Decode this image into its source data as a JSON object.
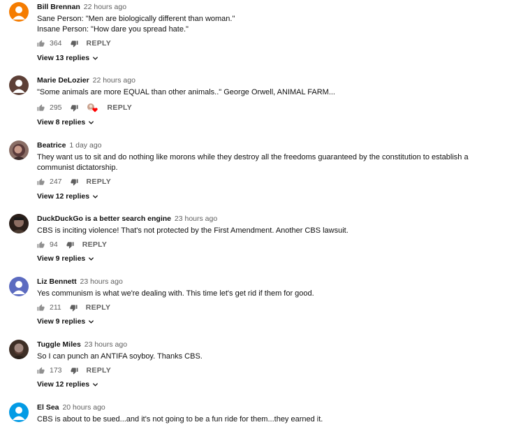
{
  "comments": [
    {
      "author": "Bill Brennan",
      "time": "22 hours ago",
      "text": "Sane Person:  \"Men are biologically different than woman.\"\nInsane Person:  \"How dare you spread hate.\"",
      "likes": "364",
      "reply_label": "REPLY",
      "replies_label": "View 13 replies",
      "avatar_color": "#f57c00",
      "avatar_icon": "person-icon"
    },
    {
      "author": "Marie DeLozier",
      "time": "22 hours ago",
      "text": "\"Some animals are more EQUAL than other animals..\" George Orwell, ANIMAL FARM...",
      "likes": "295",
      "reply_label": "REPLY",
      "replies_label": "View 8 replies",
      "avatar_color": "#5d4037",
      "avatar_icon": "person-icon",
      "creator_heart": true
    },
    {
      "author": "Beatrice",
      "time": "1 day ago",
      "text": "They want us to sit and do nothing like morons while they destroy all the freedoms guaranteed by the constitution to establish a communist dictatorship.",
      "likes": "247",
      "reply_label": "REPLY",
      "replies_label": "View 12 replies",
      "avatar_color": "#6d4c41",
      "avatar_icon": "profile-photo"
    },
    {
      "author": "DuckDuckGo is a better search engine",
      "time": "23 hours ago",
      "text": "CBS is inciting violence! That's not protected by the First Amendment. Another CBS lawsuit.",
      "likes": "94",
      "reply_label": "REPLY",
      "replies_label": "View 9 replies",
      "avatar_color": "#3e2723",
      "avatar_icon": "profile-photo"
    },
    {
      "author": "Liz Bennett",
      "time": "23 hours ago",
      "text": "Yes communism is what we're dealing with. This time let's get rid if them for good.",
      "likes": "211",
      "reply_label": "REPLY",
      "replies_label": "View 9 replies",
      "avatar_color": "#5c6bc0",
      "avatar_icon": "person-icon"
    },
    {
      "author": "Tuggle Miles",
      "time": "23 hours ago",
      "text": "So I can punch an ANTIFA soyboy. Thanks CBS.",
      "likes": "173",
      "reply_label": "REPLY",
      "replies_label": "View 12 replies",
      "avatar_color": "#4e342e",
      "avatar_icon": "profile-photo"
    },
    {
      "author": "El Sea",
      "time": "20 hours ago",
      "text": "CBS is about to be sued...and it's not going to be a fun ride for them...they earned it.",
      "avatar_color": "#039be5",
      "avatar_icon": "person-icon"
    }
  ]
}
